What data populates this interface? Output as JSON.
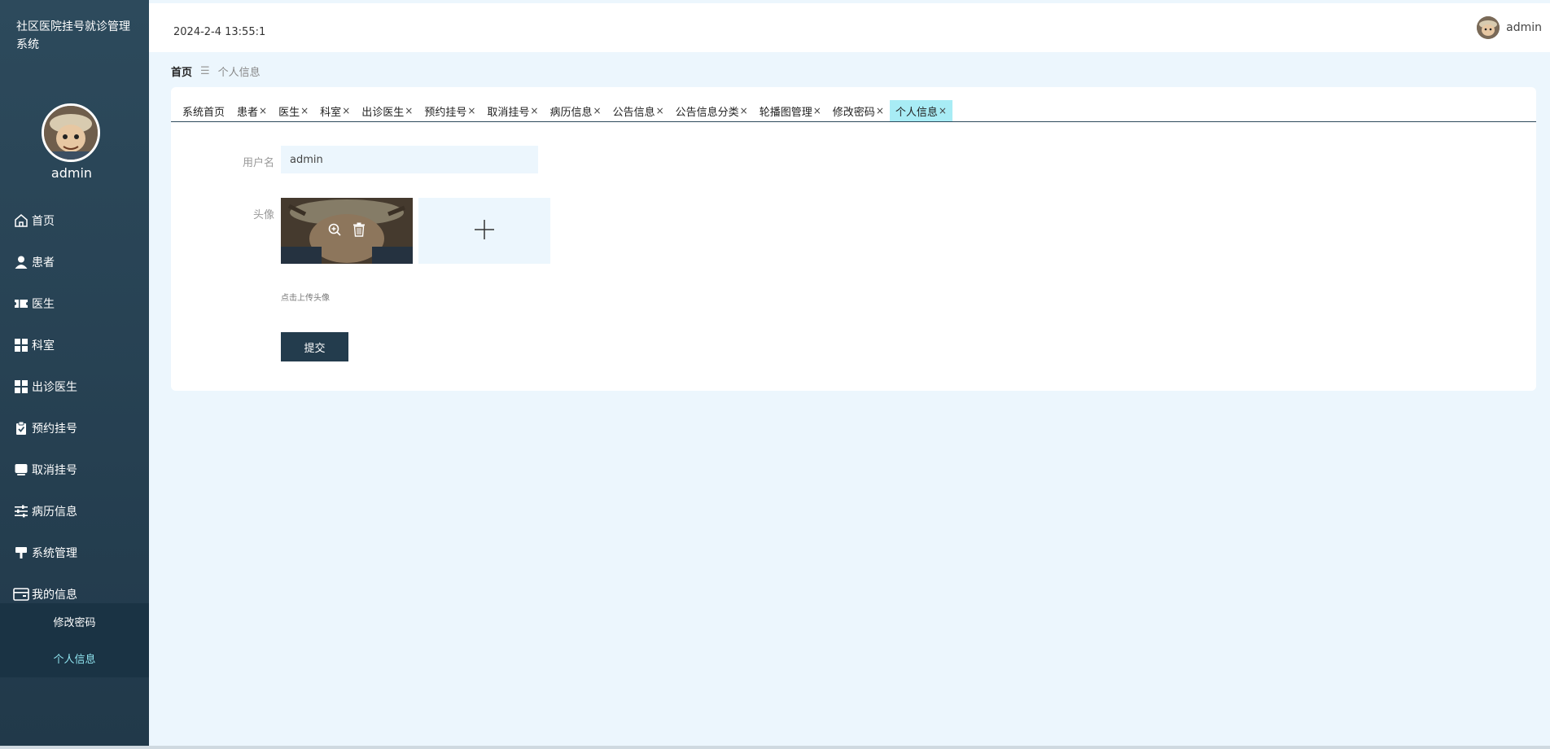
{
  "app": {
    "title": "社区医院挂号就诊管理系统"
  },
  "sidebar": {
    "username": "admin",
    "menu": [
      {
        "label": "首页",
        "icon": "home-icon"
      },
      {
        "label": "患者",
        "icon": "user-icon"
      },
      {
        "label": "医生",
        "icon": "ticket-icon"
      },
      {
        "label": "科室",
        "icon": "grid-icon"
      },
      {
        "label": "出诊医生",
        "icon": "grid-icon"
      },
      {
        "label": "预约挂号",
        "icon": "clipboard-check-icon"
      },
      {
        "label": "取消挂号",
        "icon": "monitor-icon"
      },
      {
        "label": "病历信息",
        "icon": "sliders-icon"
      },
      {
        "label": "系统管理",
        "icon": "brush-icon"
      },
      {
        "label": "我的信息",
        "icon": "wallet-icon"
      }
    ],
    "submenu": [
      {
        "label": "修改密码"
      },
      {
        "label": "个人信息"
      }
    ]
  },
  "header": {
    "datetime": "2024-2-4 13:55:1",
    "username": "admin"
  },
  "breadcrumb": {
    "home": "首页",
    "separator": "☰",
    "current": "个人信息"
  },
  "tabs": [
    {
      "label": "系统首页",
      "closable": ""
    },
    {
      "label": "患者",
      "closable": "×"
    },
    {
      "label": "医生",
      "closable": "×"
    },
    {
      "label": "科室",
      "closable": "×"
    },
    {
      "label": "出诊医生",
      "closable": "×"
    },
    {
      "label": "预约挂号",
      "closable": "×"
    },
    {
      "label": "取消挂号",
      "closable": "×"
    },
    {
      "label": "病历信息",
      "closable": "×"
    },
    {
      "label": "公告信息",
      "closable": "×"
    },
    {
      "label": "公告信息分类",
      "closable": "×"
    },
    {
      "label": "轮播图管理",
      "closable": "×"
    },
    {
      "label": "修改密码",
      "closable": "×"
    },
    {
      "label": "个人信息",
      "closable": "×"
    }
  ],
  "form": {
    "username_label": "用户名",
    "username_value": "admin",
    "avatar_label": "头像",
    "upload_hint": "点击上传头像",
    "submit_label": "提交"
  },
  "colors": {
    "sidebar_bg": "#2d4a5c",
    "accent": "#233c4d",
    "active_tab": "#a8ecf5",
    "page_bg": "#ecf6fd"
  }
}
